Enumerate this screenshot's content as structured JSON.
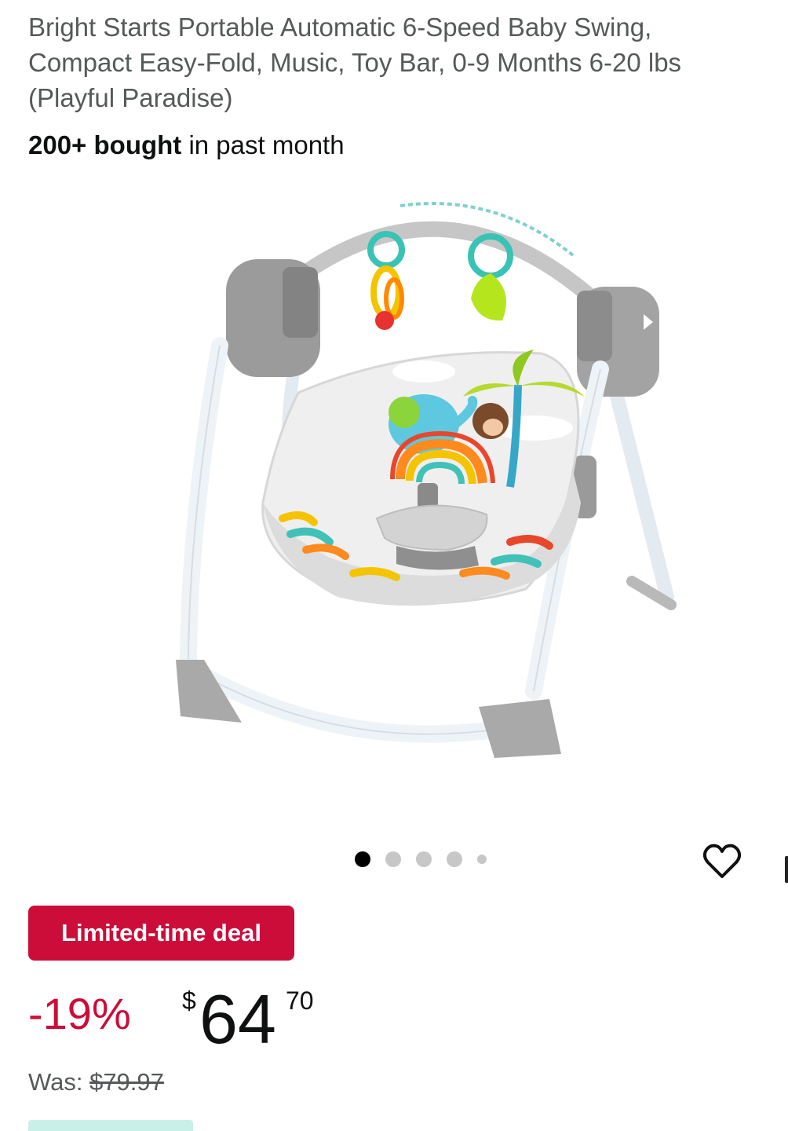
{
  "product": {
    "title": "Bright Starts Portable Automatic 6-Speed Baby Swing, Compact Easy-Fold, Music, Toy Bar, 0-9 Months 6-20 lbs (Playful Paradise)",
    "bought_count": "200+ bought",
    "bought_suffix": " in past month",
    "image_alt": "Baby swing product photo"
  },
  "carousel": {
    "dots_total": 5,
    "active_index": 0
  },
  "actions": {
    "wishlist_icon": "heart-icon"
  },
  "deal": {
    "badge": "Limited-time deal",
    "badge_color": "#cc0c39"
  },
  "pricing": {
    "discount": "-19%",
    "currency_symbol": "$",
    "price_whole": "64",
    "price_fraction": "70",
    "was_label": "Was: ",
    "was_price": "$79.97"
  }
}
